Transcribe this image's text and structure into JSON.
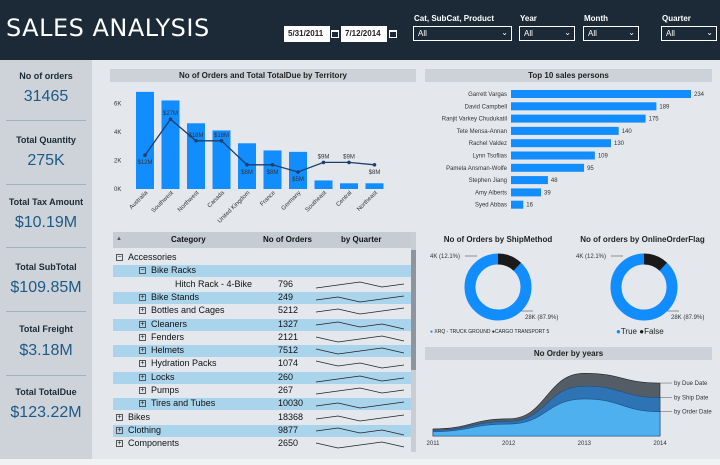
{
  "header": {
    "title": "SALES ANALYSIS",
    "date_start": "5/31/2011",
    "date_end": "7/12/2014",
    "filters": [
      {
        "label": "Cat, SubCat, Product",
        "value": "All"
      },
      {
        "label": "Year",
        "value": "All"
      },
      {
        "label": "Month",
        "value": "All"
      },
      {
        "label": "Quarter",
        "value": "All"
      }
    ]
  },
  "kpis": [
    {
      "label": "No of orders",
      "value": "31465"
    },
    {
      "label": "Total Quantity",
      "value": "275K"
    },
    {
      "label": "Total Tax Amount",
      "value": "$10.19M"
    },
    {
      "label": "Total SubTotal",
      "value": "$109.85M"
    },
    {
      "label": "Total Freight",
      "value": "$3.18M"
    },
    {
      "label": "Total TotalDue",
      "value": "$123.22M"
    }
  ],
  "territory_chart": {
    "title": "No of Orders and Total TotalDue by Territory",
    "y_ticks": [
      "6K",
      "4K",
      "2K",
      "0K"
    ],
    "chart_data": {
      "type": "bar",
      "categories": [
        "Australia",
        "Southwest",
        "Northwest",
        "Canada",
        "United Kingdom",
        "France",
        "Germany",
        "Southeast",
        "Central",
        "Northeast"
      ],
      "series": [
        {
          "values": [
            6800,
            6200,
            4600,
            4100,
            3200,
            2700,
            2600,
            600,
            400,
            400
          ]
        },
        {
          "values": [
            12,
            27,
            18,
            18,
            8,
            8,
            5,
            9,
            9,
            8
          ],
          "labels": [
            "$12M",
            "$27M",
            "$18M",
            "$18M",
            "$8M",
            "$8M",
            "$5M",
            "$9M",
            "$9M",
            "$8M"
          ]
        }
      ],
      "ylim": [
        0,
        7000
      ]
    }
  },
  "top_sales": {
    "title": "Top 10 sales persons",
    "chart_data": {
      "type": "bar",
      "categories": [
        "Garrett Vargas",
        "David Campbell",
        "Ranjit Varkey Chudukatil",
        "Tete Mensa-Annan",
        "Rachel Valdez",
        "Lynn Tsoflias",
        "Pamela Ansman-Wolfe",
        "Stephen Jiang",
        "Amy Alberts",
        "Syed Abbas"
      ],
      "values": [
        234,
        189,
        175,
        140,
        130,
        109,
        95,
        48,
        39,
        16
      ]
    }
  },
  "table": {
    "col_category": "Category",
    "col_orders": "No of Orders",
    "col_quarter": "by Quarter",
    "sort_icon": "▲",
    "rows": [
      {
        "name": "Accessories",
        "orders": "",
        "level": 0,
        "sign": "−",
        "hl": false
      },
      {
        "name": "Bike Racks",
        "orders": "",
        "level": 1,
        "sign": "−",
        "hl": true
      },
      {
        "name": "Hitch Rack - 4-Bike",
        "orders": "796",
        "level": 2,
        "sign": "",
        "hl": false
      },
      {
        "name": "Bike Stands",
        "orders": "249",
        "level": 1,
        "sign": "+",
        "hl": true
      },
      {
        "name": "Bottles and Cages",
        "orders": "5212",
        "level": 1,
        "sign": "+",
        "hl": false
      },
      {
        "name": "Cleaners",
        "orders": "1327",
        "level": 1,
        "sign": "+",
        "hl": true
      },
      {
        "name": "Fenders",
        "orders": "2121",
        "level": 1,
        "sign": "+",
        "hl": false
      },
      {
        "name": "Helmets",
        "orders": "7512",
        "level": 1,
        "sign": "+",
        "hl": true
      },
      {
        "name": "Hydration Packs",
        "orders": "1074",
        "level": 1,
        "sign": "+",
        "hl": false
      },
      {
        "name": "Locks",
        "orders": "260",
        "level": 1,
        "sign": "+",
        "hl": true
      },
      {
        "name": "Pumps",
        "orders": "267",
        "level": 1,
        "sign": "+",
        "hl": false
      },
      {
        "name": "Tires and Tubes",
        "orders": "10030",
        "level": 1,
        "sign": "+",
        "hl": true
      },
      {
        "name": "Bikes",
        "orders": "18368",
        "level": 0,
        "sign": "+",
        "hl": false
      },
      {
        "name": "Clothing",
        "orders": "9877",
        "level": 0,
        "sign": "+",
        "hl": true
      },
      {
        "name": "Components",
        "orders": "2650",
        "level": 0,
        "sign": "+",
        "hl": false
      }
    ]
  },
  "donut_ship": {
    "title": "No of Orders by ShipMethod",
    "label_small": "4K (12.1%)",
    "label_big": "28K (87.9%)",
    "legend": [
      "XRQ - TRUCK GROUND",
      "CARGO TRANSPORT 5"
    ],
    "chart_data": {
      "type": "pie",
      "categories": [
        "XRQ - TRUCK GROUND",
        "CARGO TRANSPORT 5"
      ],
      "values": [
        87.9,
        12.1
      ]
    }
  },
  "donut_flag": {
    "title": "No of orders by OnlineOrderFlag",
    "label_small": "4K (12.1%)",
    "label_big": "28K (87.9%)",
    "legend": [
      "True",
      "False"
    ],
    "chart_data": {
      "type": "pie",
      "categories": [
        "True",
        "False"
      ],
      "values": [
        87.9,
        12.1
      ]
    }
  },
  "years_chart": {
    "title": "No Order by years",
    "chart_data": {
      "type": "area",
      "x": [
        "2011",
        "2012",
        "2013",
        "2014"
      ],
      "series": [
        {
          "name": "by Due Date",
          "values": [
            1600,
            3900,
            14200,
            12000
          ]
        },
        {
          "name": "by Ship Date",
          "values": [
            1300,
            3300,
            11300,
            8700
          ]
        },
        {
          "name": "by Order Date",
          "values": [
            1000,
            2700,
            8400,
            5500
          ]
        }
      ]
    }
  },
  "colors": {
    "bar": "#118dff",
    "dark": "#1b2a36",
    "line": "#1d3f6e",
    "false_slice": "#1a1a1a"
  }
}
